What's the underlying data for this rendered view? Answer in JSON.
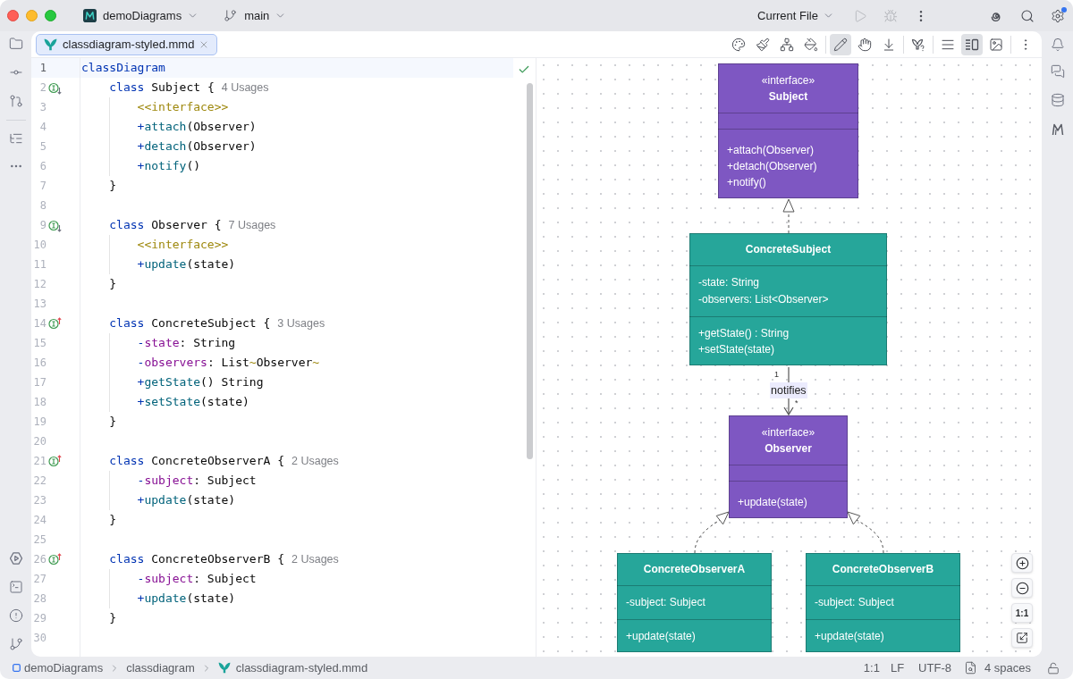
{
  "title_bar": {
    "project": "demoDiagrams",
    "branch": "main",
    "run_configuration": "Current File",
    "run_disabled": true,
    "debug_disabled": true,
    "settings_badge": true
  },
  "editor_tab": {
    "label": "classdiagram-styled.mmd",
    "selected": true
  },
  "preview_toolbar": [
    {
      "selected": false
    },
    {
      "selected": false
    },
    {
      "selected": false
    },
    {
      "selected": false
    },
    {
      "selected": true
    },
    {
      "selected": false
    },
    {
      "selected": false
    },
    {
      "selected": false
    },
    {
      "selected": false
    },
    {
      "selected": true
    },
    {
      "selected": false
    },
    {
      "selected": false
    }
  ],
  "editor": {
    "no_problems": true,
    "lines": [
      {
        "number": "1",
        "kind": "root",
        "current": true,
        "tokens": [
          {
            "kind": "keyword",
            "text": "classDiagram"
          }
        ]
      },
      {
        "number": "2",
        "kind": "declaration",
        "current": false,
        "gutter_marker": {
          "kind": "implemented"
        },
        "usages": "4 Usages",
        "tokens": [
          {
            "kind": "keyword",
            "text": "class "
          },
          {
            "kind": "plain",
            "text": "Subject {"
          }
        ]
      },
      {
        "number": "3",
        "kind": "member",
        "current": false,
        "tokens": [
          {
            "kind": "stereotype",
            "text": "<<interface>>"
          }
        ]
      },
      {
        "number": "4",
        "kind": "member",
        "current": false,
        "tokens": [
          {
            "kind": "sign",
            "text": "+"
          },
          {
            "kind": "method",
            "text": "attach"
          },
          {
            "kind": "plain",
            "text": "(Observer)"
          }
        ]
      },
      {
        "number": "5",
        "kind": "member",
        "current": false,
        "tokens": [
          {
            "kind": "sign",
            "text": "+"
          },
          {
            "kind": "method",
            "text": "detach"
          },
          {
            "kind": "plain",
            "text": "(Observer)"
          }
        ]
      },
      {
        "number": "6",
        "kind": "member",
        "current": false,
        "tokens": [
          {
            "kind": "sign",
            "text": "+"
          },
          {
            "kind": "method",
            "text": "notify"
          },
          {
            "kind": "plain",
            "text": "()"
          }
        ]
      },
      {
        "number": "7",
        "kind": "closing",
        "current": false,
        "tokens": [
          {
            "kind": "plain",
            "text": "}"
          }
        ]
      },
      {
        "number": "8",
        "kind": "blank",
        "current": false
      },
      {
        "number": "9",
        "kind": "declaration",
        "current": false,
        "gutter_marker": {
          "kind": "implemented"
        },
        "usages": "7 Usages",
        "tokens": [
          {
            "kind": "keyword",
            "text": "class "
          },
          {
            "kind": "plain",
            "text": "Observer {"
          }
        ]
      },
      {
        "number": "10",
        "kind": "member",
        "current": false,
        "tokens": [
          {
            "kind": "stereotype",
            "text": "<<interface>>"
          }
        ]
      },
      {
        "number": "11",
        "kind": "member",
        "current": false,
        "tokens": [
          {
            "kind": "sign",
            "text": "+"
          },
          {
            "kind": "method",
            "text": "update"
          },
          {
            "kind": "plain",
            "text": "(state)"
          }
        ]
      },
      {
        "number": "12",
        "kind": "closing",
        "current": false,
        "tokens": [
          {
            "kind": "plain",
            "text": "}"
          }
        ]
      },
      {
        "number": "13",
        "kind": "blank",
        "current": false
      },
      {
        "number": "14",
        "kind": "declaration",
        "current": false,
        "gutter_marker": {
          "kind": "implementing"
        },
        "usages": "3 Usages",
        "tokens": [
          {
            "kind": "keyword",
            "text": "class "
          },
          {
            "kind": "plain",
            "text": "ConcreteSubject {"
          }
        ]
      },
      {
        "number": "15",
        "kind": "member",
        "current": false,
        "tokens": [
          {
            "kind": "sign",
            "text": "-"
          },
          {
            "kind": "field",
            "text": "state"
          },
          {
            "kind": "plain",
            "text": ": String"
          }
        ]
      },
      {
        "number": "16",
        "kind": "member",
        "current": false,
        "tokens": [
          {
            "kind": "sign",
            "text": "-"
          },
          {
            "kind": "field",
            "text": "observers"
          },
          {
            "kind": "plain",
            "text": ": List"
          },
          {
            "kind": "generic",
            "text": "~"
          },
          {
            "kind": "plain",
            "text": "Observer"
          },
          {
            "kind": "generic",
            "text": "~"
          }
        ]
      },
      {
        "number": "17",
        "kind": "member",
        "current": false,
        "tokens": [
          {
            "kind": "sign",
            "text": "+"
          },
          {
            "kind": "method",
            "text": "getState"
          },
          {
            "kind": "plain",
            "text": "() String"
          }
        ]
      },
      {
        "number": "18",
        "kind": "member",
        "current": false,
        "tokens": [
          {
            "kind": "sign",
            "text": "+"
          },
          {
            "kind": "method",
            "text": "setState"
          },
          {
            "kind": "plain",
            "text": "(state)"
          }
        ]
      },
      {
        "number": "19",
        "kind": "closing",
        "current": false,
        "tokens": [
          {
            "kind": "plain",
            "text": "}"
          }
        ]
      },
      {
        "number": "20",
        "kind": "blank",
        "current": false
      },
      {
        "number": "21",
        "kind": "declaration",
        "current": false,
        "gutter_marker": {
          "kind": "implementing"
        },
        "usages": "2 Usages",
        "tokens": [
          {
            "kind": "keyword",
            "text": "class "
          },
          {
            "kind": "plain",
            "text": "ConcreteObserverA {"
          }
        ]
      },
      {
        "number": "22",
        "kind": "member",
        "current": false,
        "tokens": [
          {
            "kind": "sign",
            "text": "-"
          },
          {
            "kind": "field",
            "text": "subject"
          },
          {
            "kind": "plain",
            "text": ": Subject"
          }
        ]
      },
      {
        "number": "23",
        "kind": "member",
        "current": false,
        "tokens": [
          {
            "kind": "sign",
            "text": "+"
          },
          {
            "kind": "method",
            "text": "update"
          },
          {
            "kind": "plain",
            "text": "(state)"
          }
        ]
      },
      {
        "number": "24",
        "kind": "closing",
        "current": false,
        "tokens": [
          {
            "kind": "plain",
            "text": "}"
          }
        ]
      },
      {
        "number": "25",
        "kind": "blank",
        "current": false
      },
      {
        "number": "26",
        "kind": "declaration",
        "current": false,
        "gutter_marker": {
          "kind": "implementing"
        },
        "usages": "2 Usages",
        "tokens": [
          {
            "kind": "keyword",
            "text": "class "
          },
          {
            "kind": "plain",
            "text": "ConcreteObserverB {"
          }
        ]
      },
      {
        "number": "27",
        "kind": "member",
        "current": false,
        "tokens": [
          {
            "kind": "sign",
            "text": "-"
          },
          {
            "kind": "field",
            "text": "subject"
          },
          {
            "kind": "plain",
            "text": ": Subject"
          }
        ]
      },
      {
        "number": "28",
        "kind": "member",
        "current": false,
        "tokens": [
          {
            "kind": "sign",
            "text": "+"
          },
          {
            "kind": "method",
            "text": "update"
          },
          {
            "kind": "plain",
            "text": "(state)"
          }
        ]
      },
      {
        "number": "29",
        "kind": "closing",
        "current": false,
        "tokens": [
          {
            "kind": "plain",
            "text": "}"
          }
        ]
      },
      {
        "number": "30",
        "kind": "blank",
        "current": false
      }
    ]
  },
  "diagram": {
    "classes": [
      {
        "stereotype": "«interface»",
        "name": "Subject",
        "color": "#7e57c2",
        "methods": [
          "+attach(Observer)",
          "+detach(Observer)",
          "+notify()"
        ]
      },
      {
        "name": "ConcreteSubject",
        "color": "#26a69a",
        "attributes": [
          "-state: String",
          "-observers: List<Observer>"
        ],
        "methods": [
          "+getState() : String",
          "+setState(state)"
        ]
      },
      {
        "stereotype": "«interface»",
        "name": "Observer",
        "color": "#7e57c2",
        "methods": [
          "+update(state)"
        ]
      },
      {
        "name": "ConcreteObserverA",
        "color": "#26a69a",
        "attributes": [
          "-subject: Subject"
        ],
        "methods": [
          "+update(state)"
        ]
      },
      {
        "name": "ConcreteObserverB",
        "color": "#26a69a",
        "attributes": [
          "-subject: Subject"
        ],
        "methods": [
          "+update(state)"
        ]
      }
    ],
    "relations": [
      {
        "kind": "realization"
      },
      {
        "kind": "association",
        "label": "notifies",
        "from_multiplicity": "1",
        "to_multiplicity": "*"
      },
      {
        "kind": "realization"
      },
      {
        "kind": "realization"
      }
    ],
    "zoom_controls": {
      "actual_size": "1:1"
    }
  },
  "status_bar": {
    "breadcrumbs": [
      {
        "kind": "project",
        "label": "demoDiagrams"
      },
      {
        "kind": "folder",
        "label": "classdiagram"
      },
      {
        "kind": "file",
        "label": "classdiagram-styled.mmd"
      }
    ],
    "position": "1:1",
    "line_separator": "LF",
    "encoding": "UTF-8",
    "indent": "4 spaces"
  }
}
